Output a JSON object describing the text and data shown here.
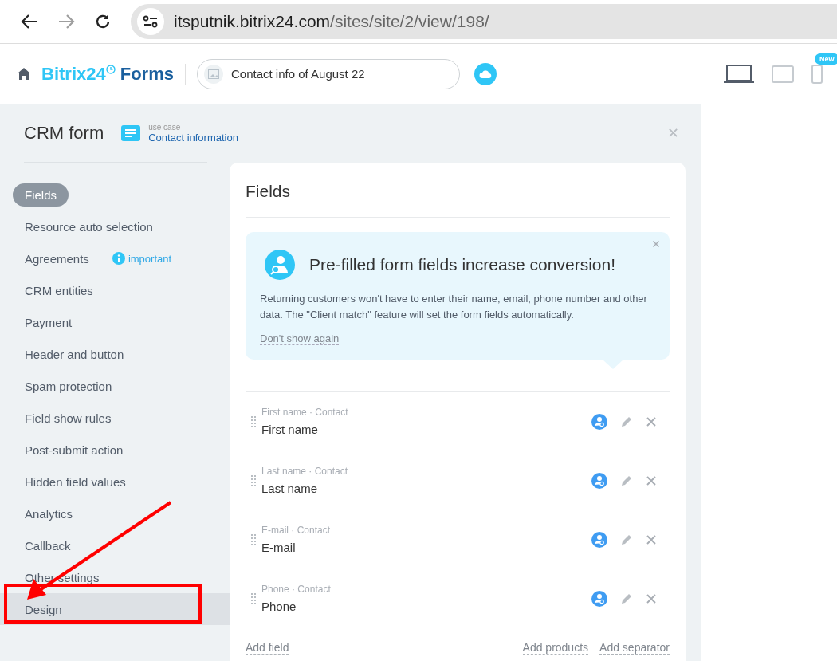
{
  "browser": {
    "back_disabled": false,
    "forward_disabled": true,
    "url_host": "itsputnik.bitrix24.com",
    "url_path": "/sites/site/2/view/198/"
  },
  "header": {
    "logo_name": "Bitrix24",
    "logo_suffix": "Forms",
    "page_title": "Contact info of August 22",
    "devices": [
      {
        "kind": "desktop",
        "selected": true
      },
      {
        "kind": "tablet",
        "selected": false
      },
      {
        "kind": "mobile",
        "selected": false,
        "badge": "New"
      }
    ]
  },
  "panel": {
    "title": "CRM form",
    "use_case_label": "use case",
    "use_case_link": "Contact information"
  },
  "sidebar": {
    "items": [
      {
        "label": "Fields",
        "selected": true,
        "highlighted": false
      },
      {
        "label": "Resource auto selection",
        "selected": false,
        "highlighted": false
      },
      {
        "label": "Agreements",
        "selected": false,
        "highlighted": false,
        "badge": "important"
      },
      {
        "label": "CRM entities",
        "selected": false,
        "highlighted": false
      },
      {
        "label": "Payment",
        "selected": false,
        "highlighted": false
      },
      {
        "label": "Header and button",
        "selected": false,
        "highlighted": false
      },
      {
        "label": "Spam protection",
        "selected": false,
        "highlighted": false
      },
      {
        "label": "Field show rules",
        "selected": false,
        "highlighted": false
      },
      {
        "label": "Post-submit action",
        "selected": false,
        "highlighted": false
      },
      {
        "label": "Hidden field values",
        "selected": false,
        "highlighted": false
      },
      {
        "label": "Analytics",
        "selected": false,
        "highlighted": false
      },
      {
        "label": "Callback",
        "selected": false,
        "highlighted": false
      },
      {
        "label": "Other settings",
        "selected": false,
        "highlighted": false
      },
      {
        "label": "Design",
        "selected": false,
        "highlighted": true
      }
    ]
  },
  "card": {
    "title": "Fields",
    "promo": {
      "title": "Pre-filled form fields increase conversion!",
      "text": "Returning customers won't have to enter their name, email, phone number and other data. The \"Client match\" feature will set the form fields automatically.",
      "dismiss": "Don't show again"
    },
    "fields": [
      {
        "caption": "First name · Contact",
        "name": "First name"
      },
      {
        "caption": "Last name · Contact",
        "name": "Last name"
      },
      {
        "caption": "E-mail · Contact",
        "name": "E-mail"
      },
      {
        "caption": "Phone · Contact",
        "name": "Phone"
      }
    ],
    "actions_left": [
      "Add field"
    ],
    "actions_right": [
      "Add products",
      "Add separator"
    ]
  }
}
